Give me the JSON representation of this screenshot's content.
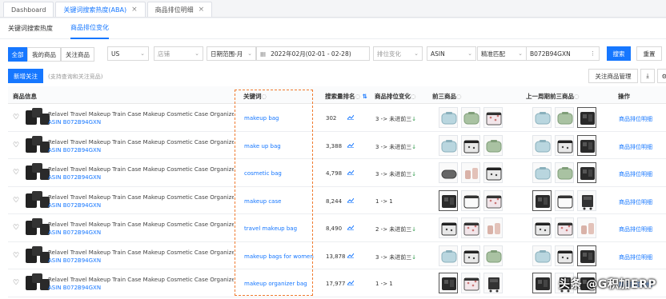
{
  "page_tabs": [
    {
      "label": "Dashboard",
      "closable": false,
      "active": false
    },
    {
      "label": "关键词搜索热度(ABA)",
      "closable": true,
      "active": true
    },
    {
      "label": "商品排位明细",
      "closable": true,
      "active": false
    }
  ],
  "sub_tabs": [
    {
      "label": "关键词搜索热度",
      "active": false
    },
    {
      "label": "商品排位变化",
      "active": true
    }
  ],
  "filters": {
    "scope_buttons": [
      "全部",
      "我的商品",
      "关注商品"
    ],
    "marketplace": "US",
    "shop_placeholder": "店铺",
    "date_range_type": "日期范围-月",
    "date_range": "2022年02月(02-01 - 02-28)",
    "rank_change_placeholder": "排位变化",
    "id_type": "ASIN",
    "match_type": "精准匹配",
    "search_value": "B072B94GXN",
    "search_label": "搜索",
    "reset_label": "重置"
  },
  "actions": {
    "new_follow_label": "新增关注",
    "new_follow_hint": "(支持查询和关注竞品)",
    "manage_label": "关注商品管理"
  },
  "table": {
    "headers": {
      "product": "商品信息",
      "keyword": "关键词",
      "rank": "搜索量排名",
      "change": "商品排位变化",
      "top3": "前三商品",
      "prev_top3": "上一周期前三商品",
      "op": "操作"
    },
    "rows": [
      {
        "name": "Relavel Travel Makeup Train Case Makeup Cosmetic Case Organizer Porta...",
        "asin": "ASIN B072B94GXN",
        "keyword": "makeup bag",
        "rank": "302",
        "change_text": "3 -> 未进前三",
        "change_down": true,
        "op": "商品排位明细",
        "top3": [
          "light-blue-bag-icon",
          "green-bag-icon",
          "pink-pattern-bag-icon"
        ],
        "prev": [
          "light-blue-bag-icon",
          "green-bag-icon",
          "black-case-icon"
        ]
      },
      {
        "name": "Relavel Travel Makeup Train Case Makeup Cosmetic Case Organizer Porta...",
        "asin": "ASIN B072B94GXN",
        "keyword": "make up bag",
        "rank": "3,388",
        "change_text": "3 -> 未进前三",
        "change_down": true,
        "op": "商品排位明细",
        "top3": [
          "light-blue-bag-icon",
          "black-pattern-bag-icon",
          "green-bag-icon"
        ],
        "prev": [
          "light-blue-bag-icon",
          "black-pattern-bag-icon",
          "black-case-icon"
        ]
      },
      {
        "name": "Relavel Travel Makeup Train Case Makeup Cosmetic Case Organizer Porta...",
        "asin": "ASIN B072B94GXN",
        "keyword": "cosmetic bag",
        "rank": "4,798",
        "change_text": "3 -> 未进前三",
        "change_down": true,
        "op": "商品排位明细",
        "top3": [
          "grey-pouch-icon",
          "pink-set-icon",
          "black-pattern-bag-icon"
        ],
        "prev": [
          "light-blue-bag-icon",
          "green-bag-icon",
          "black-case-icon"
        ]
      },
      {
        "name": "Relavel Travel Makeup Train Case Makeup Cosmetic Case Organizer Porta...",
        "asin": "ASIN B072B94GXN",
        "keyword": "makeup case",
        "rank": "8,244",
        "change_text": "1 -> 1",
        "change_down": false,
        "op": "商品排位明细",
        "top3": [
          "black-case-icon",
          "white-case-icon",
          "pink-pattern-bag-icon"
        ],
        "prev": [
          "black-case-icon",
          "white-case-icon",
          "black-trolley-icon"
        ]
      },
      {
        "name": "Relavel Travel Makeup Train Case Makeup Cosmetic Case Organizer Porta...",
        "asin": "ASIN B072B94GXN",
        "keyword": "travel makeup bag",
        "rank": "8,490",
        "change_text": "2 -> 未进前三",
        "change_down": true,
        "op": "商品排位明细",
        "top3": [
          "black-pattern-bag-icon",
          "pink-pattern-bag-icon",
          "pink-set-icon"
        ],
        "prev": [
          "black-pattern-bag-icon",
          "pink-pattern-bag-icon",
          "pink-set-icon"
        ]
      },
      {
        "name": "Relavel Travel Makeup Train Case Makeup Cosmetic Case Organizer Porta...",
        "asin": "ASIN B072B94GXN",
        "keyword": "makeup bags for women",
        "rank": "13,878",
        "change_text": "3 -> 未进前三",
        "change_down": true,
        "op": "商品排位明细",
        "top3": [
          "light-blue-bag-icon",
          "black-pattern-bag-icon",
          "green-bag-icon"
        ],
        "prev": [
          "light-blue-bag-icon",
          "black-pattern-bag-icon",
          "black-case-icon"
        ]
      },
      {
        "name": "Relavel Travel Makeup Train Case Makeup Cosmetic Case Organizer Porta...",
        "asin": "ASIN B072B94GXN",
        "keyword": "makeup organizer bag",
        "rank": "17,977",
        "change_text": "1 -> 1",
        "change_down": false,
        "op": "商品排位明细",
        "top3": [
          "black-case-icon",
          "pink-pattern-bag-icon",
          "black-trolley-icon"
        ],
        "prev": [
          "black-case-icon",
          "black-trolley-icon",
          "black-case-icon"
        ]
      }
    ]
  },
  "watermark": "头条 @G积加ERP",
  "colors": {
    "accent": "#1677ff",
    "highlight_border": "#f07a2e",
    "down_arrow": "#2e9a4a"
  }
}
